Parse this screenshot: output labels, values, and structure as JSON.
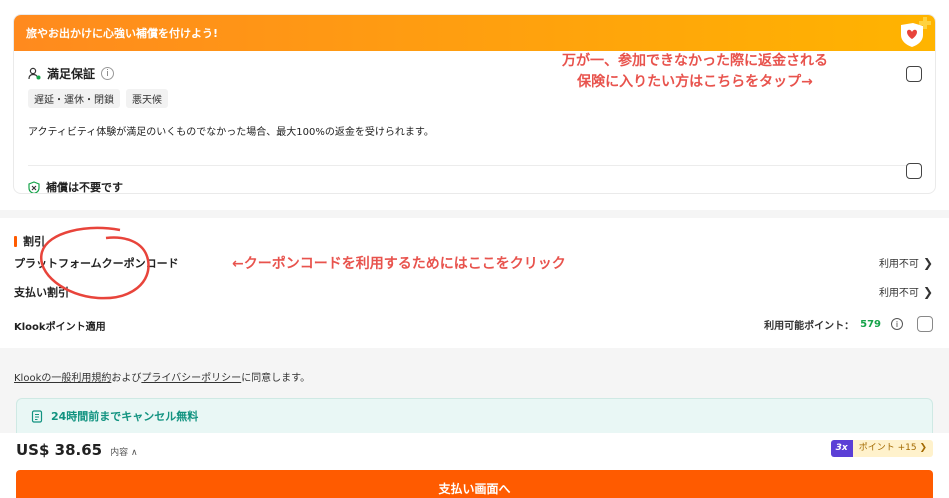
{
  "insurance": {
    "banner_text": "旅やお出かけに心強い補償を付けよう!",
    "plan_title": "満足保証",
    "tags": [
      "遅延・運休・閉鎖",
      "悪天候"
    ],
    "plan_description": "アクティビティ体験が満足のいくものでなかった場合、最大100%の返金を受けられます。",
    "no_insurance_label": "補償は不要です"
  },
  "annotations": {
    "insurance_note_line1": "万が一、参加できなかった際に返金される",
    "insurance_note_line2": "保険に入りたい方はこちらをタップ→",
    "coupon_note": "←クーポンコードを利用するためにはここをクリック"
  },
  "discount": {
    "section_title": "割引",
    "coupon_label": "プラットフォームクーポンコード",
    "coupon_status": "利用不可",
    "payment_discount_label": "支払い割引",
    "payment_discount_status": "利用不可",
    "klook_points_label": "Klookポイント適用",
    "available_points_label": "利用可能ポイント：",
    "available_points_value": "579"
  },
  "terms": {
    "link1": "Klookの一般利用規約",
    "and": "および",
    "link2": "プライバシーポリシー",
    "suffix": "に同意します。"
  },
  "cancellation": {
    "text": "24時間前までキャンセル無料"
  },
  "footer": {
    "price": "US$ 38.65",
    "breakdown_label": "内容",
    "multiplier": "3x",
    "points_text": "ポイント +15",
    "pay_button": "支払い画面へ"
  },
  "colors": {
    "brand_orange": "#ff5b00",
    "banner_gradient_start": "#ff8a1e",
    "banner_gradient_end": "#ffb400",
    "annotation_red": "#e8534d",
    "points_green": "#16a34a",
    "cancel_teal": "#119380"
  }
}
